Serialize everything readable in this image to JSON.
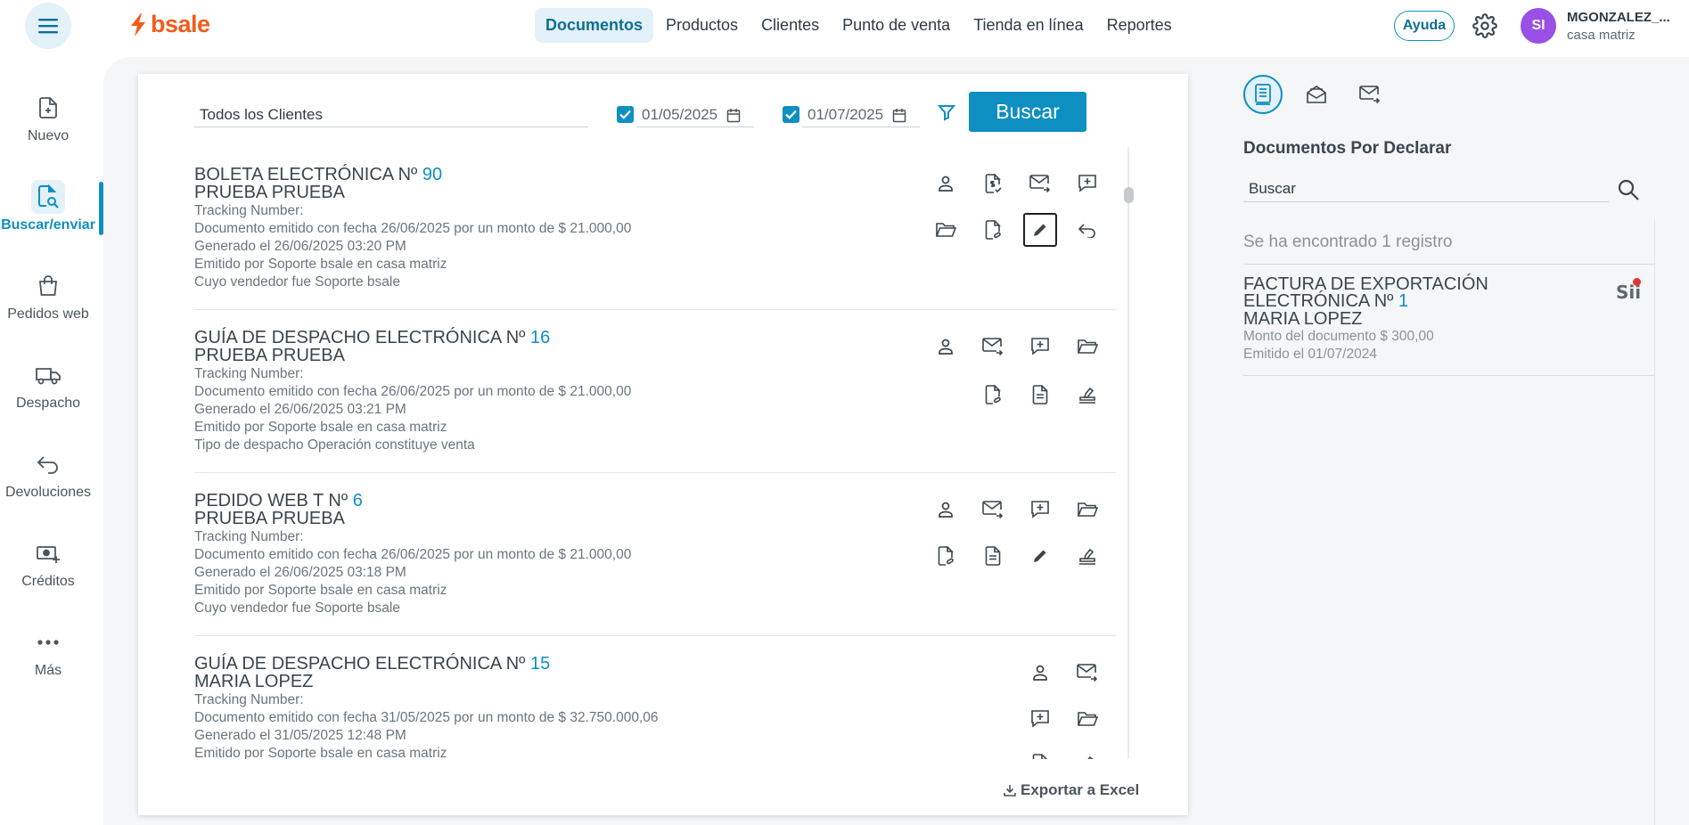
{
  "header": {
    "logo_text": "bsale",
    "nav": [
      {
        "label": "Documentos",
        "active": true
      },
      {
        "label": "Productos"
      },
      {
        "label": "Clientes"
      },
      {
        "label": "Punto de venta"
      },
      {
        "label": "Tienda en línea"
      },
      {
        "label": "Reportes"
      }
    ],
    "help_label": "Ayuda",
    "user": {
      "initials": "SI",
      "name": "MGONZALEZ_...",
      "branch": "casa matriz"
    }
  },
  "sidebar": {
    "items": [
      {
        "label": "Nuevo",
        "icon": "file-plus-icon"
      },
      {
        "label": "Buscar/enviar",
        "icon": "file-search-icon",
        "active": true
      },
      {
        "label": "Pedidos web",
        "icon": "shopping-bag-icon"
      },
      {
        "label": "Despacho",
        "icon": "truck-icon"
      },
      {
        "label": "Devoluciones",
        "icon": "return-arrow-icon"
      },
      {
        "label": "Créditos",
        "icon": "cash-plus-icon"
      },
      {
        "label": "Más",
        "icon": "more-dots-icon"
      }
    ]
  },
  "filters": {
    "client": "Todos los Clientes",
    "date_from": "01/05/2025",
    "date_to": "01/07/2025",
    "search_label": "Buscar"
  },
  "documents": [
    {
      "title": "BOLETA ELECTRÓNICA Nº",
      "number": "90",
      "client": "PRUEBA PRUEBA",
      "lines": [
        "Tracking Number:",
        "Documento emitido con fecha 26/06/2025 por un monto de $ 21.000,00",
        "Generado el 26/06/2025 03:20 PM",
        "Emitido por Soporte bsale en casa matriz",
        "Cuyo vendedor fue Soporte bsale"
      ]
    },
    {
      "title": "GUÍA DE DESPACHO ELECTRÓNICA Nº",
      "number": "16",
      "client": "PRUEBA PRUEBA",
      "lines": [
        "Tracking Number:",
        "Documento emitido con fecha 26/06/2025 por un monto de $ 21.000,00",
        "Generado el 26/06/2025 03:21 PM",
        "Emitido por Soporte bsale en casa matriz",
        "Tipo de despacho Operación constituye venta"
      ]
    },
    {
      "title": "PEDIDO WEB T Nº",
      "number": "6",
      "client": "PRUEBA PRUEBA",
      "lines": [
        "Tracking Number:",
        "Documento emitido con fecha 26/06/2025 por un monto de $ 21.000,00",
        "Generado el 26/06/2025 03:18 PM",
        "Emitido por Soporte bsale en casa matriz",
        "Cuyo vendedor fue Soporte bsale"
      ]
    },
    {
      "title": "GUÍA DE DESPACHO ELECTRÓNICA Nº",
      "number": "15",
      "client": "MARIA LOPEZ",
      "lines": [
        "Tracking Number:",
        "Documento emitido con fecha 31/05/2025 por un monto de $ 32.750.000,06",
        "Generado el 31/05/2025 12:48 PM",
        "Emitido por Soporte bsale en casa matriz"
      ]
    }
  ],
  "export_label": "Exportar a Excel",
  "right_panel": {
    "title": "Documentos Por Declarar",
    "search_placeholder": "Buscar",
    "found_text": "Se ha encontrado 1 registro",
    "pending": {
      "title_line1": "FACTURA DE EXPORTACIÓN",
      "title_line2": "ELECTRÓNICA Nº",
      "number": "1",
      "client": "MARIA LOPEZ",
      "amount": "Monto del documento $ 300,00",
      "issued": "Emitido el 01/07/2024",
      "badge": "Sii"
    }
  },
  "colors": {
    "brand": "#f25c19",
    "accent": "#0d8fc2",
    "accent_bg": "#e3f1f8",
    "avatar": "#9a4fe6"
  }
}
